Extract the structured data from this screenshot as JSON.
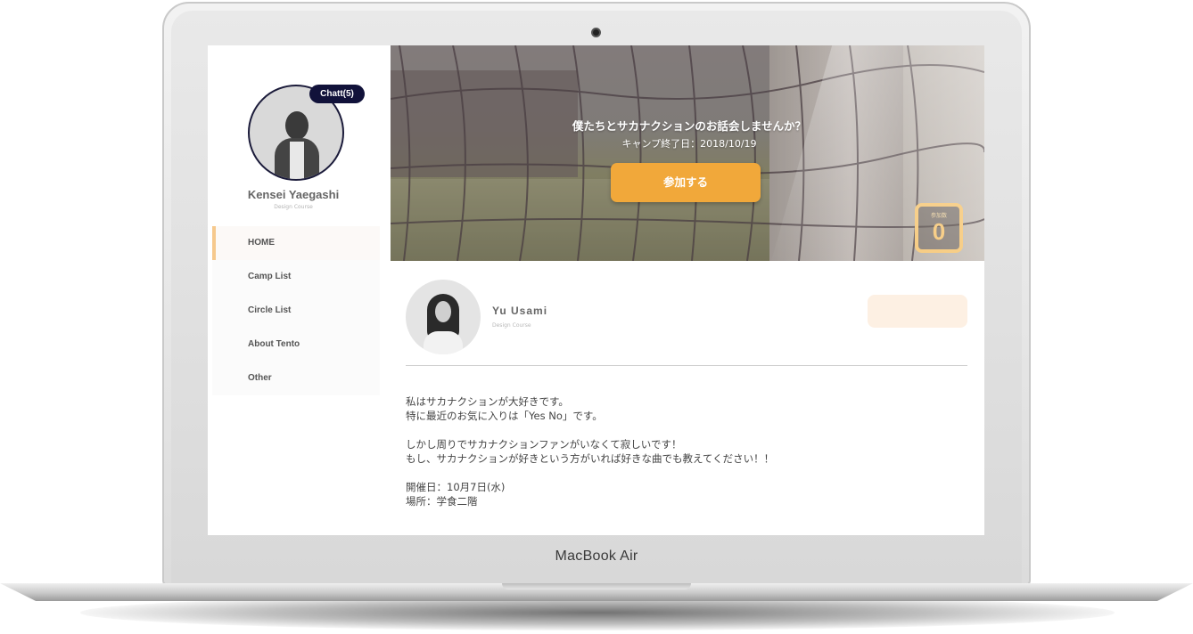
{
  "device": {
    "brand_label": "MacBook Air"
  },
  "sidebar": {
    "chat_badge": "Chatt(5)",
    "user_name": "Kensei Yaegashi",
    "user_course": "Design Course",
    "nav": [
      {
        "label": "HOME",
        "active": true
      },
      {
        "label": "Camp List",
        "active": false
      },
      {
        "label": "Circle List",
        "active": false
      },
      {
        "label": "About Tento",
        "active": false
      },
      {
        "label": "Other",
        "active": false
      }
    ]
  },
  "banner": {
    "title": "僕たちとサカナクションのお話会しませんか？",
    "date_text": "キャンプ終了日：2018/10/19",
    "join_button": "参加する",
    "participants_label": "参加数",
    "participants_count": "0"
  },
  "post": {
    "author_name": "Yu Usami",
    "author_course": "Design Course",
    "body_lines": [
      "私はサカナクションが大好きです。",
      "特に最近のお気に入りは「Yes No」です。",
      "",
      "しかし周りでサカナクションファンがいなくて寂しいです！",
      "もし、サカナクションが好きという方がいれば好きな曲でも教えてください！！",
      "",
      "開催日：10月7日(水)",
      "場所：学食二階"
    ]
  },
  "colors": {
    "accent_orange": "#f1a83a",
    "badge_navy": "#11123a",
    "active_nav_border": "#f6c98d",
    "count_border": "#f6c879"
  }
}
